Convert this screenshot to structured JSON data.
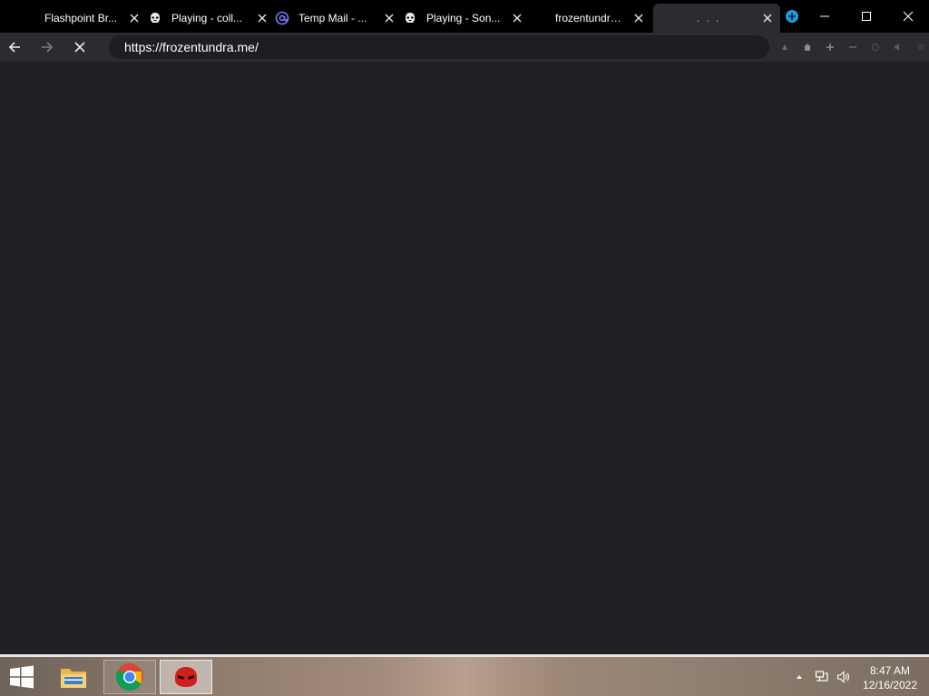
{
  "browser": {
    "tabs": [
      {
        "title": "Flashpoint Br...",
        "favicon": "none"
      },
      {
        "title": "Playing - coll...",
        "favicon": "stormtrooper-icon"
      },
      {
        "title": "Temp Mail - ...",
        "favicon": "at-sign-icon"
      },
      {
        "title": "Playing - Son...",
        "favicon": "stormtrooper-icon"
      },
      {
        "title": "frozentundra....",
        "favicon": "none"
      },
      {
        "title": ". . .",
        "favicon": "none"
      }
    ],
    "address_url": "https://frozentundra.me/",
    "colors": {
      "tab_strip": "#000000",
      "toolbar": "#2b2c30",
      "page": "#202124",
      "accent": "#1a9be6"
    }
  },
  "taskbar": {
    "apps": [
      "file-explorer-icon",
      "chrome-icon",
      "flashpoint-icon"
    ],
    "clock": {
      "time": "8:47 AM",
      "date": "12/16/2022"
    }
  }
}
